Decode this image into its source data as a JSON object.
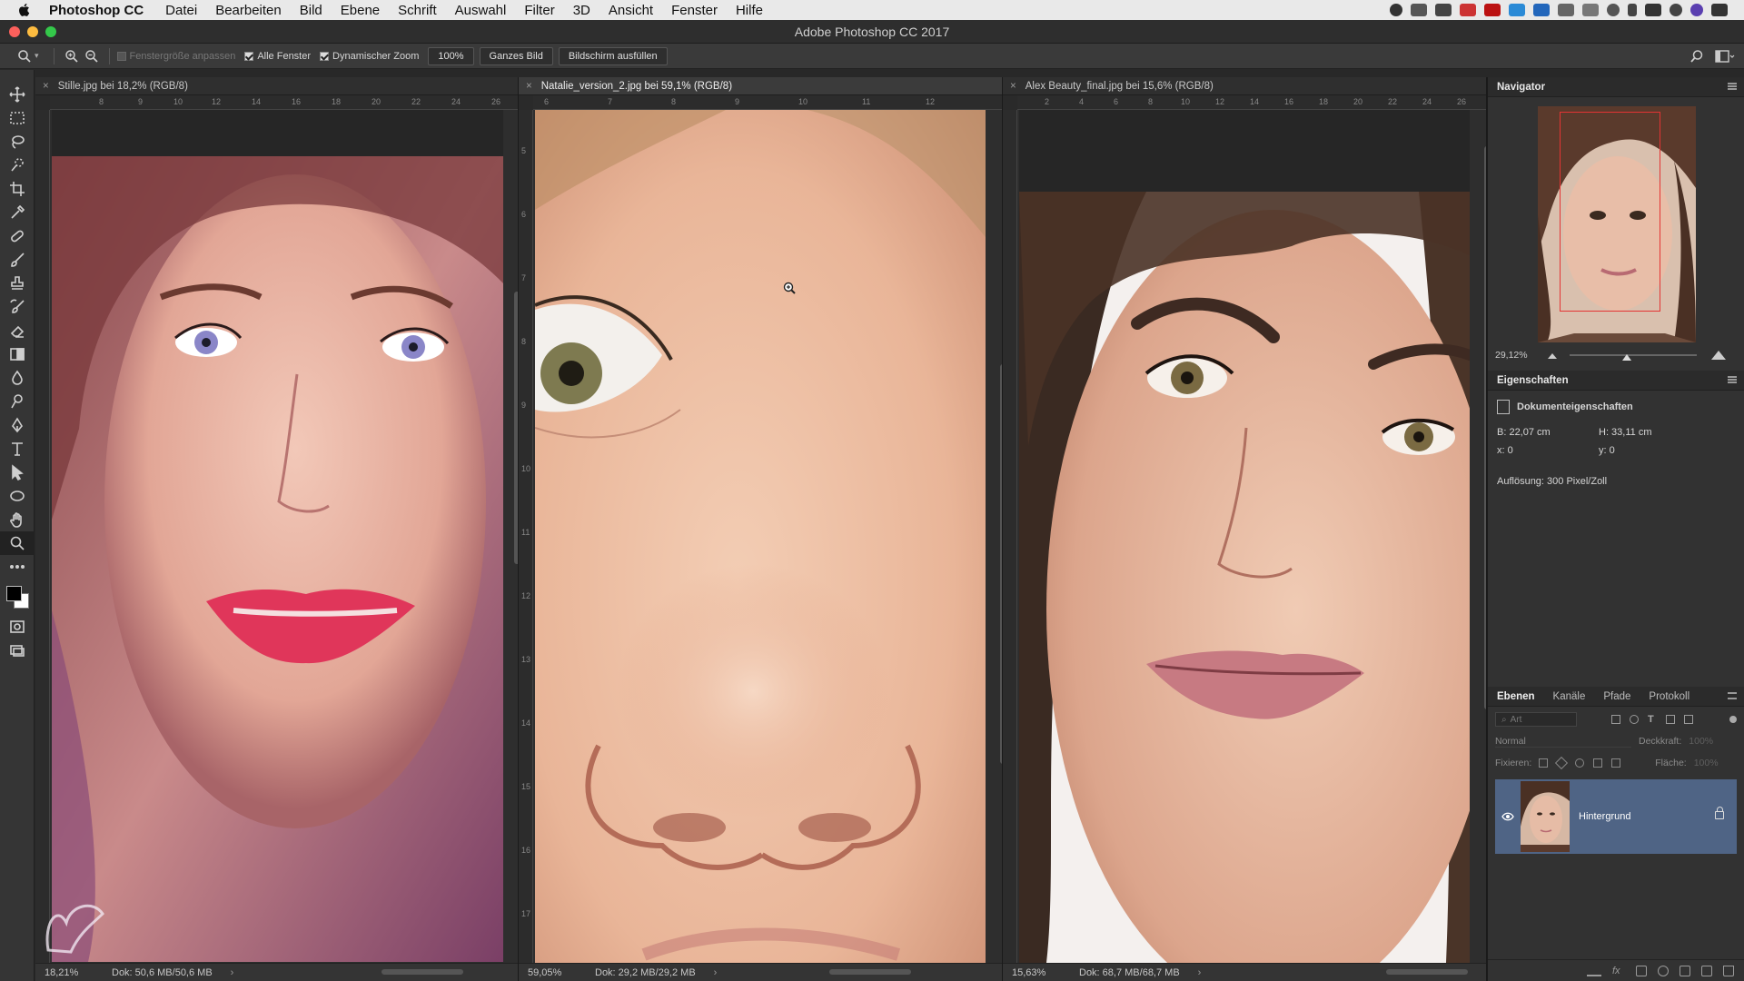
{
  "menubar": {
    "app": "Photoshop CC",
    "items": [
      "Datei",
      "Bearbeiten",
      "Bild",
      "Ebene",
      "Schrift",
      "Auswahl",
      "Filter",
      "3D",
      "Ansicht",
      "Fenster",
      "Hilfe"
    ]
  },
  "window": {
    "title": "Adobe Photoshop CC 2017"
  },
  "options": {
    "fit_windows": "Fenstergröße anpassen",
    "all_windows": "Alle Fenster",
    "scrubby_zoom": "Dynamischer Zoom",
    "zoom_100": "100%",
    "fit_screen": "Ganzes Bild",
    "fill_screen": "Bildschirm ausfüllen"
  },
  "documents": [
    {
      "tab": "Stille.jpg bei 18,2% (RGB/8)",
      "zoom": "18,21%",
      "info": "Dok: 50,6 MB/50,6 MB"
    },
    {
      "tab": "Natalie_version_2.jpg bei 59,1% (RGB/8)",
      "zoom": "59,05%",
      "info": "Dok: 29,2 MB/29,2 MB"
    },
    {
      "tab": "Alex Beauty_final.jpg bei 15,6% (RGB/8)",
      "zoom": "15,63%",
      "info": "Dok: 68,7 MB/68,7 MB"
    }
  ],
  "rulers": {
    "doc1_h": [
      "8",
      "9",
      "10",
      "12",
      "14",
      "16",
      "18",
      "20",
      "22",
      "24",
      "26"
    ],
    "doc2_h": [
      "6",
      "7",
      "8",
      "9",
      "10",
      "11",
      "12"
    ],
    "doc3_h": [
      "2",
      "4",
      "6",
      "8",
      "10",
      "12",
      "14",
      "16",
      "18",
      "20",
      "22",
      "24",
      "26"
    ],
    "doc2_v": [
      "5",
      "6",
      "7",
      "8",
      "9",
      "10",
      "11",
      "12",
      "13",
      "14",
      "15",
      "16",
      "17"
    ]
  },
  "navigator": {
    "title": "Navigator",
    "zoom": "29,12%"
  },
  "properties": {
    "title": "Eigenschaften",
    "section": "Dokumenteigenschaften",
    "width": "B: 22,07 cm",
    "height": "H: 33,11 cm",
    "x": "x: 0",
    "y": "y: 0",
    "resolution": "Auflösung: 300 Pixel/Zoll"
  },
  "layers": {
    "tabs": [
      "Ebenen",
      "Kanäle",
      "Pfade",
      "Protokoll"
    ],
    "filter_placeholder": "Art",
    "blend_mode": "Normal",
    "opacity_label": "Deckkraft:",
    "opacity_value": "100%",
    "lock_label": "Fixieren:",
    "fill_label": "Fläche:",
    "fill_value": "100%",
    "items": [
      {
        "name": "Hintergrund"
      }
    ]
  },
  "colors": {
    "accent": "#4f6485",
    "nav_box": "#e43434"
  }
}
